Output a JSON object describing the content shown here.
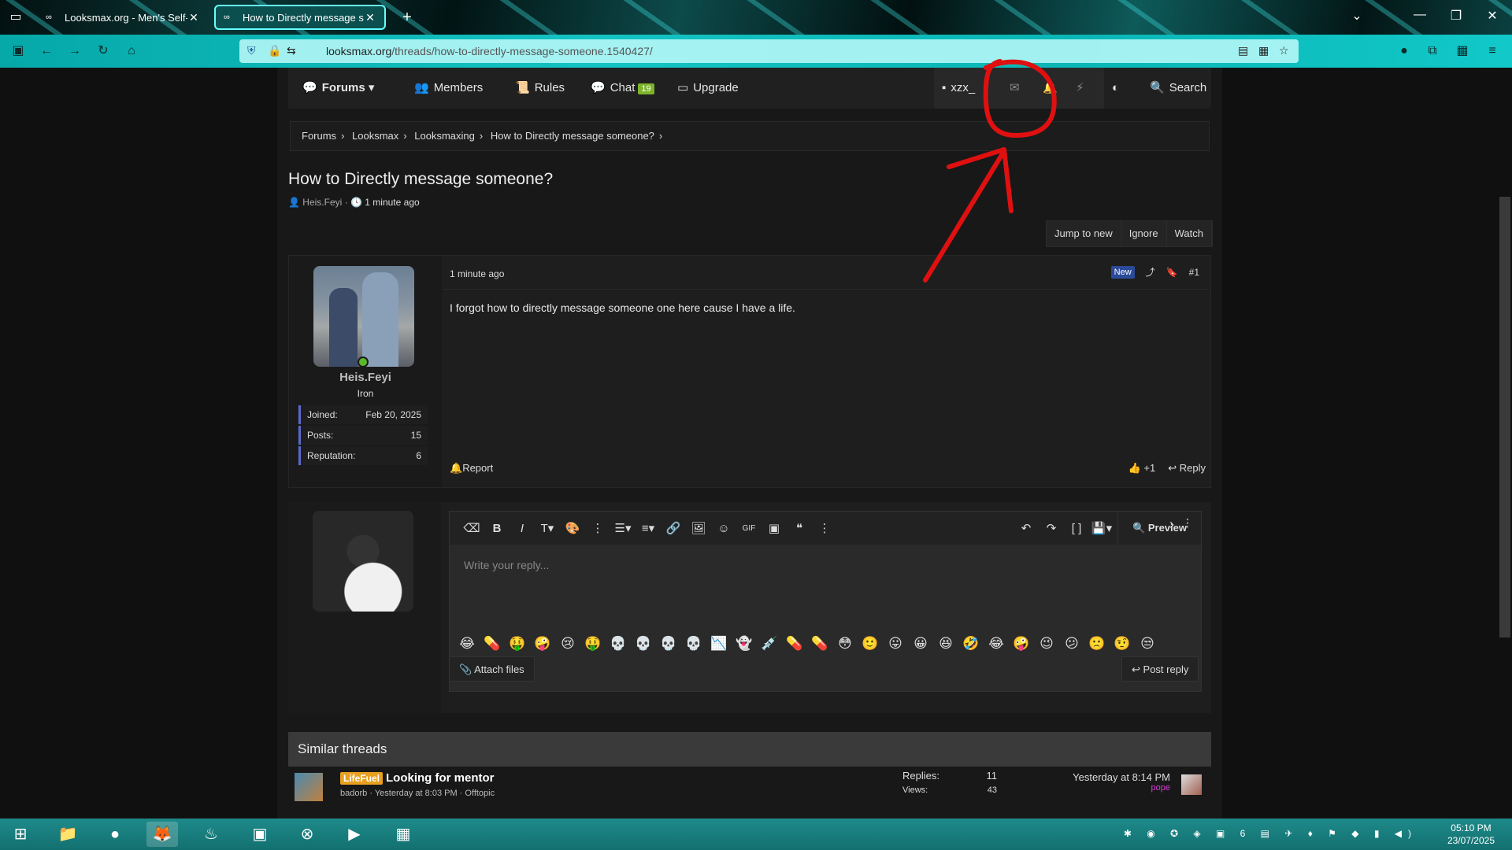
{
  "browser": {
    "tabs": [
      {
        "title": "Looksmax.org - Men's Self-Improvement",
        "active": false
      },
      {
        "title": "How to Directly message someone?",
        "active": true
      }
    ],
    "url_host": "looksmax.org",
    "url_path": "/threads/how-to-directly-message-someone.1540427/"
  },
  "site_nav": {
    "forums": "Forums",
    "members": "Members",
    "rules": "Rules",
    "chat": "Chat",
    "chat_count": "19",
    "upgrade": "Upgrade",
    "username": "xzx_",
    "search": "Search"
  },
  "breadcrumb": [
    "Forums",
    "Looksmax",
    "Looksmaxing",
    "How to Directly message someone?"
  ],
  "thread": {
    "title": "How to Directly message someone?",
    "author": "Heis.Feyi",
    "time": "1 minute ago",
    "buttons": [
      "Jump to new",
      "Ignore",
      "Watch"
    ]
  },
  "post": {
    "time": "1 minute ago",
    "badge": "New",
    "number": "#1",
    "body": "I forgot how to directly message someone one here cause I have a life.",
    "user": {
      "name": "Heis.Feyi",
      "title": "Iron",
      "stats": [
        {
          "k": "Joined:",
          "v": "Feb 20, 2025"
        },
        {
          "k": "Posts:",
          "v": "15"
        },
        {
          "k": "Reputation:",
          "v": "6"
        }
      ]
    },
    "report": "Report",
    "reaction": "+1",
    "reply": "Reply"
  },
  "editor": {
    "placeholder": "Write your reply...",
    "preview": "Preview",
    "attach": "Attach files",
    "post_reply": "Post reply"
  },
  "similar": {
    "heading": "Similar threads",
    "rows": [
      {
        "prefix": "LifeFuel",
        "title": "Looking for mentor",
        "author": "badorb",
        "date": "Yesterday at 8:03 PM",
        "forum": "Offtopic",
        "replies_label": "Replies:",
        "replies": "11",
        "views_label": "Views:",
        "views": "43",
        "last_time": "Yesterday at 8:14 PM",
        "last_user": "pope"
      }
    ]
  },
  "taskbar": {
    "clock_time": "05:10 PM",
    "clock_date": "23/07/2025"
  },
  "colors": {
    "accent": "#14c3c3",
    "annotation": "#e01010",
    "online": "#5ab82a",
    "new_badge": "#2a4a9a"
  }
}
